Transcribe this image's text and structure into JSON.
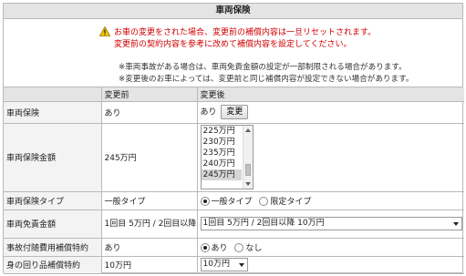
{
  "section_title": "車両保険",
  "notice": {
    "warning_line1": "お車の変更をされた場合、変更前の補償内容は一旦リセットされます。",
    "warning_line2": "変更前の契約内容を参考に改めて補償内容を設定してください。",
    "note_line1": "※車両事故がある場合は、車両免責金額の設定が一部制限される場合があります。",
    "note_line2": "※変更後のお車によっては、変更前と同じ補償内容が設定できない場合があります。"
  },
  "columns": {
    "before": "変更前",
    "after": "変更後"
  },
  "rows": {
    "vehicle_insurance": {
      "label": "車両保険",
      "before": "あり",
      "after": "あり",
      "button": "変更"
    },
    "amount": {
      "label": "車両保険金額",
      "before": "245万円",
      "options": [
        "225万円",
        "230万円",
        "235万円",
        "240万円",
        "245万円"
      ],
      "selected_index": 4
    },
    "type": {
      "label": "車両保険タイプ",
      "before": "一般タイプ",
      "option_general": "一般タイプ",
      "option_limited": "限定タイプ",
      "selected": "general"
    },
    "deductible": {
      "label": "車両免責金額",
      "before": "1回目 5万円 / 2回目以降 10万円",
      "selected": "1回目 5万円 / 2回目以降 10万円"
    },
    "accident_costs": {
      "label": "事故付随費用補償特約",
      "before": "あり",
      "option_yes": "あり",
      "option_no": "なし",
      "selected": "yes"
    },
    "belongings": {
      "label": "身の回り品補償特約",
      "before": "10万円",
      "selected": "10万円"
    }
  },
  "colors": {
    "warning_text": "#d00000",
    "header_bg": "#e4e4e4",
    "border": "#b9b9b9"
  }
}
